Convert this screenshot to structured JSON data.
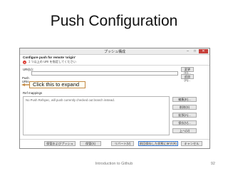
{
  "slide": {
    "title": "Push Configuration",
    "footer": "Introduction to Github",
    "page_number": "92"
  },
  "window": {
    "title": "プッシュ構成",
    "controls": [
      "–",
      "□",
      "✕"
    ]
  },
  "dialog": {
    "header": "Configure push for remote 'origin'",
    "warning": "１つ以上の URI を指定してください",
    "uri_label": "URI(U):",
    "change_button": "変更(C)...",
    "add_button": "追加(A)...",
    "push_urls_label": "Push URIs",
    "ref_mappings_label": "Ref mappings",
    "refspec_placeholder": "No Push Refspec, will push currently checked out branch instead.",
    "side_buttons": [
      "編集(E)...",
      "削除(D)",
      "拡張(A)...",
      "保存(V)...",
      "上へ(U)"
    ],
    "bottom_buttons": [
      "保管およびプッシュ",
      "保管(S)",
      "リバート(V)",
      "前回保存した状態に戻す(R)",
      "キャンセル"
    ]
  },
  "annotation": {
    "callout_text": "Click this to expand"
  },
  "colors": {
    "close_button": "#c7403a",
    "warning_icon": "#d9342b",
    "callout_border": "#c48a45",
    "primary_button_border": "#3a7bd5"
  }
}
